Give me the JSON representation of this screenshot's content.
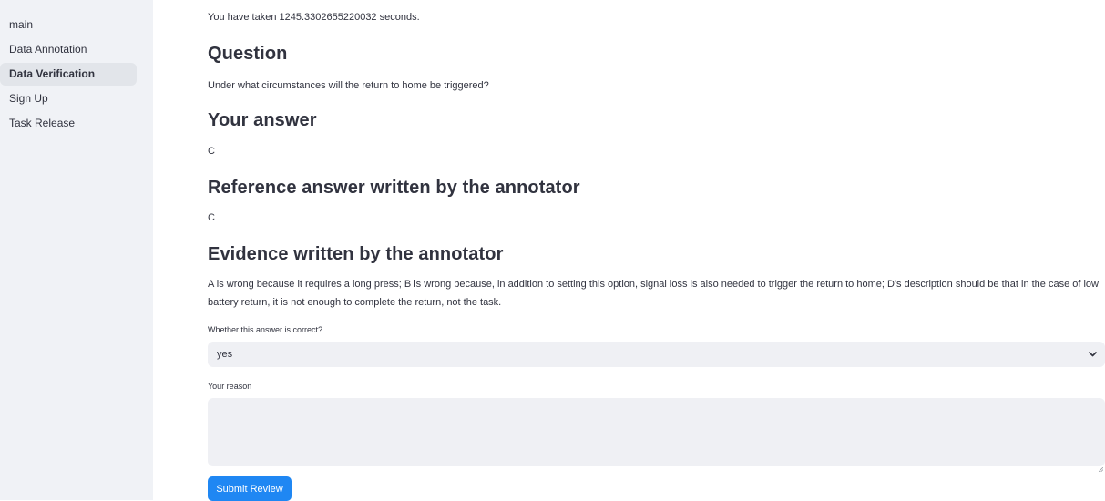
{
  "sidebar": {
    "items": [
      {
        "label": "main"
      },
      {
        "label": "Data Annotation"
      },
      {
        "label": "Data Verification"
      },
      {
        "label": "Sign Up"
      },
      {
        "label": "Task Release"
      }
    ]
  },
  "main": {
    "timer_text": "You have taken 1245.3302655220032 seconds.",
    "question_heading": "Question",
    "question_text": "Under what circumstances will the return to home be triggered?",
    "your_answer_heading": "Your answer",
    "your_answer_value": "C",
    "reference_heading": "Reference answer written by the annotator",
    "reference_value": "C",
    "evidence_heading": "Evidence written by the annotator",
    "evidence_text": "A is wrong because it requires a long press; B is wrong because, in addition to setting this option, signal loss is also needed to trigger the return to home; D's description should be that in the case of low battery return, it is not enough to complete the return, not the task.",
    "correct_label": "Whether this answer is correct?",
    "correct_selected": "yes",
    "reason_label": "Your reason",
    "reason_value": "",
    "submit_label": "Submit Review"
  },
  "colors": {
    "sidebar_bg": "#f0f2f6",
    "active_item_bg": "#e2e5ea",
    "input_bg": "#eff0f4",
    "primary_button": "#1f87f3",
    "text": "#31333f"
  },
  "icons": {
    "select_indicator": "chevron-down-icon",
    "textarea_grip": "resize-grip-icon"
  }
}
